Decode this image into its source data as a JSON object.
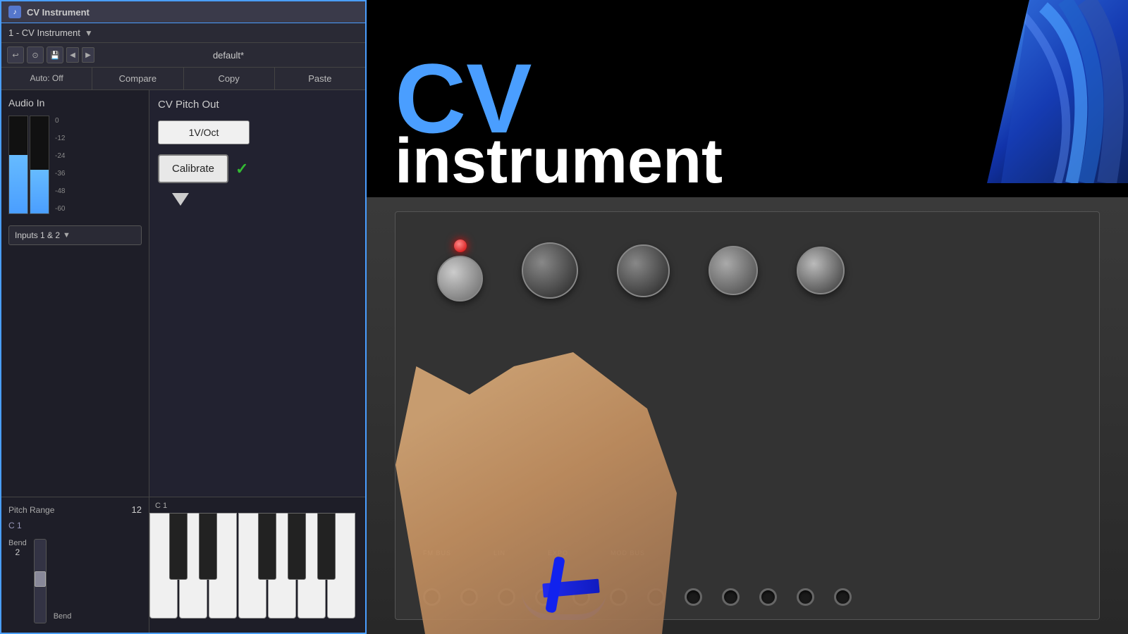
{
  "titleBar": {
    "title": "CV Instrument",
    "icon": "♪"
  },
  "instrumentBar": {
    "name": "1 - CV Instrument",
    "arrow": "▼"
  },
  "toolbar": {
    "icons": [
      "↩",
      "⊙",
      "💾",
      "◀",
      "▶"
    ],
    "presetName": "default*"
  },
  "presetActions": {
    "autoOff": "Auto: Off",
    "compare": "Compare",
    "copy": "Copy",
    "paste": "Paste"
  },
  "audioIn": {
    "title": "Audio In",
    "meterLabels": [
      "0",
      "-12",
      "-24",
      "-36",
      "-48",
      "-60"
    ]
  },
  "inputsSelector": {
    "label": "Inputs 1 & 2",
    "arrow": "▼"
  },
  "cvPitchOut": {
    "title": "CV Pitch Out",
    "voltOct": "1V/Oct",
    "calibrate": "Calibrate",
    "checkMark": "✓"
  },
  "pitchBend": {
    "rangeLabel": "Pitch Range",
    "rangeValue": "12",
    "keyNote": "C 1",
    "bendLabel": "Bend",
    "bendValue": "2",
    "bendBottomLabel": "Bend"
  },
  "video": {
    "cvText": "CV",
    "instrumentText": "instrument",
    "description": "CV instrument tutorial thumbnail with modular synthesizer"
  }
}
